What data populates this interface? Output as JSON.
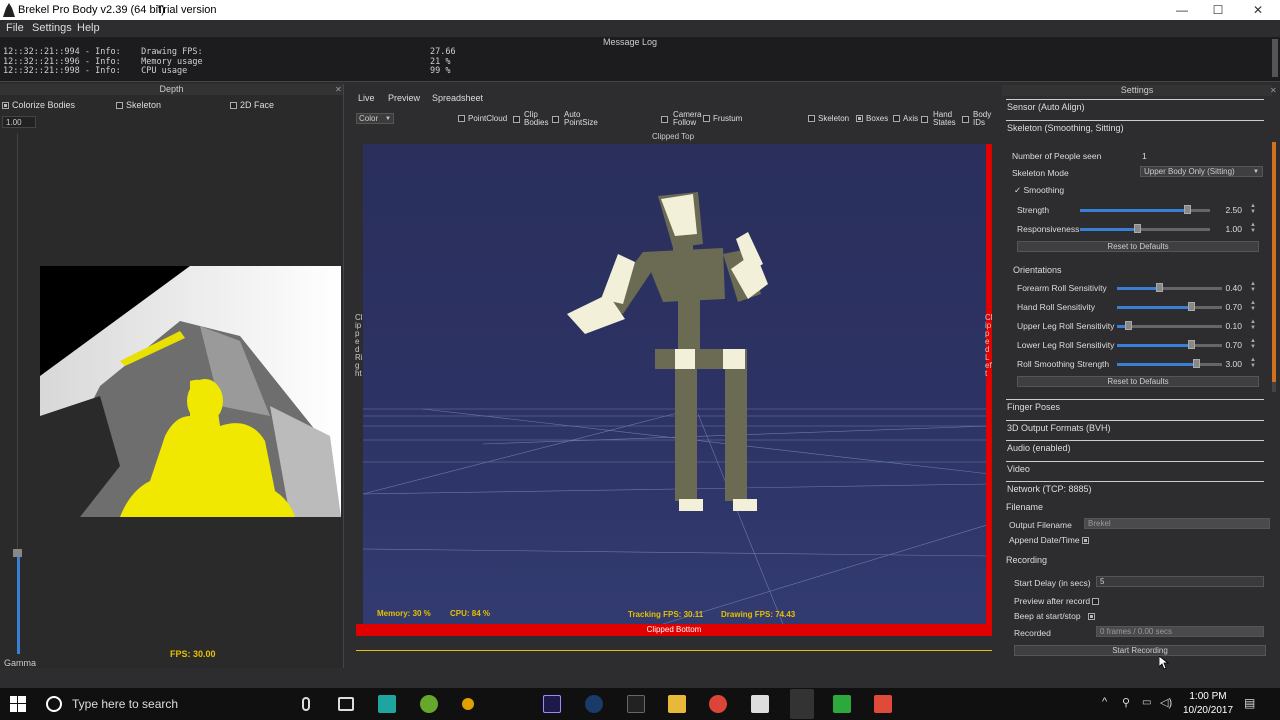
{
  "window": {
    "title": "Brekel Pro Body v2.39 (64 bit)",
    "trial": "Trial version",
    "min": "—",
    "max": "☐",
    "close": "✕"
  },
  "menu": {
    "file": "File",
    "settings": "Settings",
    "help": "Help"
  },
  "message_log": {
    "title": "Message Log",
    "lines": [
      {
        "text": "12::32::21::994 - Info:    Drawing FPS:",
        "value": "27.66"
      },
      {
        "text": "12::32::21::996 - Info:    Memory usage",
        "value": "21 %"
      },
      {
        "text": "12::32::21::998 - Info:    CPU usage",
        "value": "99 %"
      }
    ]
  },
  "depth_panel": {
    "title": "Depth",
    "colorize": "Colorize Bodies",
    "skeleton": "Skeleton",
    "face2d": "2D Face",
    "spin_value": "1.00",
    "gamma_label": "Gamma",
    "fps": "FPS: 30.00"
  },
  "viewport": {
    "tabs": [
      "Live",
      "Preview",
      "Spreadsheet"
    ],
    "color_select": "Color",
    "toolbar": {
      "pointcloud": "PointCloud",
      "clip_bodies": "Clip Bodies",
      "auto_pointsize": "Auto PointSize",
      "camera_follow": "Camera Follow",
      "frustum": "Frustum",
      "skeleton": "Skeleton",
      "boxes": "Boxes",
      "axis": "Axis",
      "hand_states": "Hand States",
      "body_ids": "Body IDs"
    },
    "clipped_top": "Clipped Top",
    "clipped_bottom": "Clipped Bottom",
    "clipped_right": "Clipped Right",
    "clipped_left": "Clipped Left",
    "memory": "Memory: 30 %",
    "cpu": "CPU: 84 %",
    "tracking_fps": "Tracking FPS: 30.11",
    "drawing_fps": "Drawing FPS: 74.43"
  },
  "settings": {
    "title": "Settings",
    "sections_top": [
      "Sensor (Auto Align)",
      "Skeleton (Smoothing, Sitting)"
    ],
    "people_seen_label": "Number of People seen",
    "people_seen_value": "1",
    "skeleton_mode_label": "Skeleton Mode",
    "skeleton_mode_value": "Upper Body Only (Sitting)",
    "smoothing": "Smoothing",
    "strength": {
      "label": "Strength",
      "value": "2.50",
      "level": 0.82
    },
    "responsiveness": {
      "label": "Responsiveness",
      "value": "1.00",
      "level": 0.44
    },
    "reset1": "Reset to Defaults",
    "orientations": "Orientations",
    "sliders": [
      {
        "label": "Forearm Roll Sensitivity",
        "value": "0.40",
        "level": 0.4
      },
      {
        "label": "Hand Roll Sensitivity",
        "value": "0.70",
        "level": 0.7
      },
      {
        "label": "Upper Leg Roll Sensitivity",
        "value": "0.10",
        "level": 0.1
      },
      {
        "label": "Lower Leg Roll Sensitivity",
        "value": "0.70",
        "level": 0.7
      },
      {
        "label": "Roll Smoothing Strength",
        "value": "3.00",
        "level": 0.75
      }
    ],
    "reset2": "Reset to Defaults",
    "sections_bottom": [
      "Finger Poses",
      "3D Output Formats (BVH)",
      "Audio (enabled)",
      "Video",
      "Network (TCP: 8885)"
    ],
    "filename_title": "Filename",
    "output_filename_label": "Output Filename",
    "output_filename_value": "Brekel",
    "append_datetime": "Append Date/Time",
    "recording_title": "Recording",
    "start_delay_label": "Start Delay (in secs)",
    "start_delay_value": "5",
    "preview_after_record": "Preview after record",
    "beep": "Beep at start/stop",
    "recorded_label": "Recorded",
    "recorded_value": "0 frames / 0.00 secs",
    "start_recording": "Start Recording"
  },
  "taskbar": {
    "search": "Type here to search",
    "time": "1:00 PM",
    "date": "10/20/2017"
  },
  "colors": {
    "accent": "#3a7fd6",
    "clip_red": "#e00000",
    "stat_yellow": "#e6c000",
    "scene_bg": "#2c3263"
  }
}
